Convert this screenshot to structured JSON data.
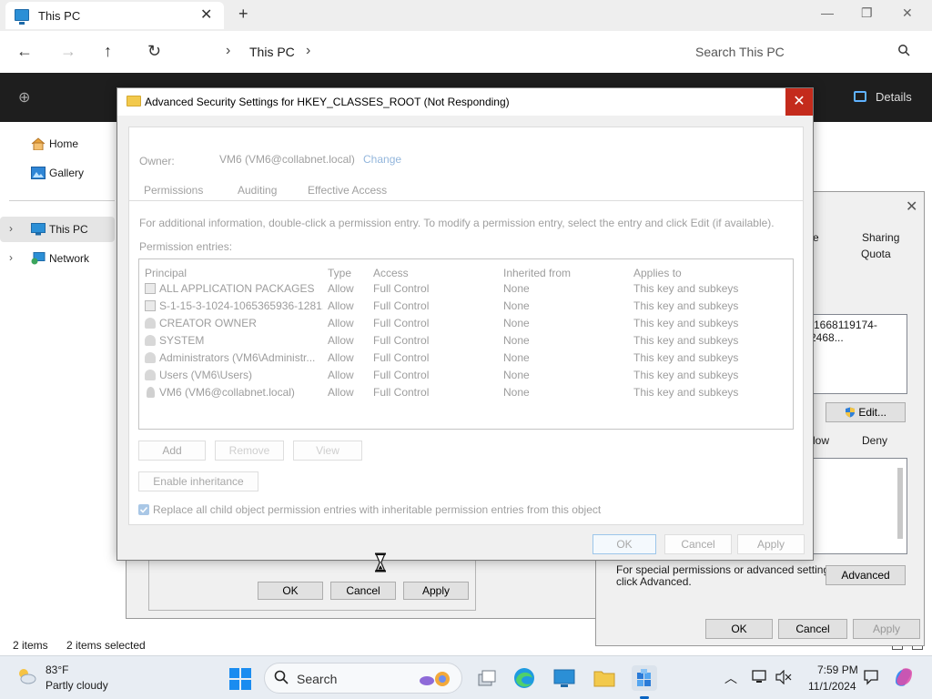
{
  "explorer": {
    "tab_title": "This PC",
    "new_tab": "+",
    "window_controls": {
      "minimize": "—",
      "restore": "❐",
      "close": "✕"
    },
    "nav": {
      "back": "←",
      "forward": "→",
      "up": "↑",
      "refresh": "↻"
    },
    "address": {
      "separator": "›",
      "crumb": "This PC",
      "trailing_separator": "›"
    },
    "search_placeholder": "Search This PC",
    "commandbar": {
      "new_label": "⊕",
      "details_label": "Details"
    },
    "sidebar": {
      "items": [
        {
          "label": "Home",
          "icon": "home-icon"
        },
        {
          "label": "Gallery",
          "icon": "gallery-icon"
        },
        {
          "label": "This PC",
          "icon": "computer-icon",
          "expand": "›",
          "selected": true
        },
        {
          "label": "Network",
          "icon": "network-icon",
          "expand": "›"
        }
      ]
    },
    "status": {
      "items": "2 items",
      "selected": "2 items selected"
    }
  },
  "perm_bg": {
    "buttons": {
      "ok": "OK",
      "cancel": "Cancel",
      "apply": "Apply"
    }
  },
  "props": {
    "close": "✕",
    "tabs": {
      "sharing": "Sharing",
      "quota": "Quota",
      "partial_tab": "e"
    },
    "sid_fragment": "-1668119174-2468...",
    "edit_button": "Edit...",
    "col_allow": "low",
    "col_deny": "Deny",
    "special_text_1": "For special permissions or advanced settings,",
    "special_text_2": "click Advanced.",
    "advanced_button": "Advanced",
    "buttons": {
      "ok": "OK",
      "cancel": "Cancel",
      "apply": "Apply"
    }
  },
  "adv": {
    "title": "Advanced Security Settings for HKEY_CLASSES_ROOT (Not Responding)",
    "close": "✕",
    "owner_label": "Owner:",
    "owner_value": "VM6 (VM6@collabnet.local)",
    "owner_change": "Change",
    "tabs": [
      "Permissions",
      "Auditing",
      "Effective Access"
    ],
    "info": "For additional information, double-click a permission entry. To modify a permission entry, select the entry and click Edit (if available).",
    "entries_label": "Permission entries:",
    "columns": [
      "Principal",
      "Type",
      "Access",
      "Inherited from",
      "Applies to"
    ],
    "rows": [
      {
        "icon": "package-icon",
        "principal": "ALL APPLICATION PACKAGES",
        "type": "Allow",
        "access": "Full Control",
        "inherited": "None",
        "applies": "This key and subkeys"
      },
      {
        "icon": "package-icon",
        "principal": "S-1-15-3-1024-1065365936-1281...",
        "type": "Allow",
        "access": "Full Control",
        "inherited": "None",
        "applies": "This key and subkeys"
      },
      {
        "icon": "group-icon",
        "principal": "CREATOR OWNER",
        "type": "Allow",
        "access": "Full Control",
        "inherited": "None",
        "applies": "This key and subkeys"
      },
      {
        "icon": "group-icon",
        "principal": "SYSTEM",
        "type": "Allow",
        "access": "Full Control",
        "inherited": "None",
        "applies": "This key and subkeys"
      },
      {
        "icon": "group-icon",
        "principal": "Administrators (VM6\\Administr...",
        "type": "Allow",
        "access": "Full Control",
        "inherited": "None",
        "applies": "This key and subkeys"
      },
      {
        "icon": "group-icon",
        "principal": "Users (VM6\\Users)",
        "type": "Allow",
        "access": "Full Control",
        "inherited": "None",
        "applies": "This key and subkeys"
      },
      {
        "icon": "user-icon",
        "principal": "VM6 (VM6@collabnet.local)",
        "type": "Allow",
        "access": "Full Control",
        "inherited": "None",
        "applies": "This key and subkeys"
      }
    ],
    "buttons": {
      "add": "Add",
      "remove": "Remove",
      "view": "View",
      "enable_inheritance": "Enable inheritance"
    },
    "replace_checkbox_label": "Replace all child object permission entries with inheritable permission entries from this object",
    "replace_checked": true,
    "footer": {
      "ok": "OK",
      "cancel": "Cancel",
      "apply": "Apply"
    }
  },
  "taskbar": {
    "weather_temp": "83°F",
    "weather_desc": "Partly cloudy",
    "search_placeholder": "Search",
    "search_icon": "🔍",
    "tray_chevron": "︿",
    "time": "7:59 PM",
    "date": "11/1/2024"
  },
  "colors": {
    "close_red": "#c42b1c",
    "windows_blue": "#1a8cf0",
    "cmdbar_dark": "#1e1e1e",
    "folder_yellow": "#f2c94c"
  }
}
